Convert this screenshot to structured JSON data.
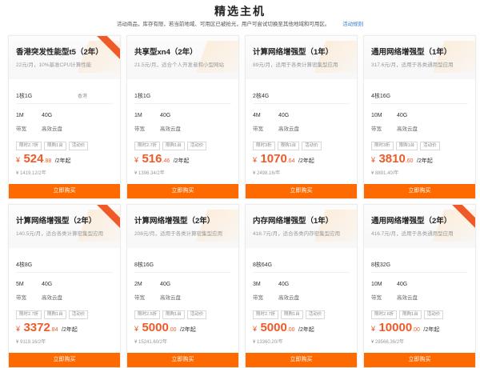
{
  "header": {
    "title": "精选主机",
    "subtitle": "活动商品，库存有限，若当前地域、可用区已被抢光，用户可尝试切换至其他地域和可用区。",
    "rules_link": "活动规则"
  },
  "labels": {
    "bandwidth": "带宽",
    "disk": "高效云盘",
    "buy": "立即购买",
    "currency": "¥",
    "per_period": "/2年起"
  },
  "colors": {
    "accent": "#ff6a00",
    "price": "#f05a28",
    "link": "#3a7bd5"
  },
  "cards": [
    {
      "title": "香港突发性能型t5（2年）",
      "desc": "22元/月，10%基准CPU计算性能",
      "spec": "1核1G",
      "note": "香港",
      "bandwidth": "1M",
      "disk": "40G",
      "tags": [
        "限时2.7折",
        "限购1台",
        "活动价"
      ],
      "price_int": "524",
      "price_dec": ".88",
      "orig": "¥ 1419.12/2年",
      "ribbon": true
    },
    {
      "title": "共享型xn4（2年）",
      "desc": "21.5元/月，适合个人开发者和小型网站",
      "spec": "1核1G",
      "note": "",
      "bandwidth": "1M",
      "disk": "40G",
      "tags": [
        "限时2.7折",
        "限购1台",
        "活动价"
      ],
      "price_int": "516",
      "price_dec": ".46",
      "orig": "¥ 1396.34/2年",
      "ribbon": false
    },
    {
      "title": "计算网络增强型（1年）",
      "desc": "89元/月，适用于各类计算密集型应用",
      "spec": "2核4G",
      "note": "",
      "bandwidth": "4M",
      "disk": "40G",
      "tags": [
        "限时3折",
        "限购1台",
        "活动价"
      ],
      "price_int": "1070",
      "price_dec": ".64",
      "orig": "¥ 2498.16/年",
      "ribbon": false
    },
    {
      "title": "通用网络增强型（1年）",
      "desc": "317.6元/月，适用于各类通用型应用",
      "spec": "4核16G",
      "note": "",
      "bandwidth": "10M",
      "disk": "40G",
      "tags": [
        "限时3折",
        "限购1台",
        "活动价"
      ],
      "price_int": "3810",
      "price_dec": ".60",
      "orig": "¥ 8891.40/年",
      "ribbon": false
    },
    {
      "title": "计算网络增强型（2年）",
      "desc": "140.5元/月，适合各类计算密集型应用",
      "spec": "4核8G",
      "note": "",
      "bandwidth": "5M",
      "disk": "40G",
      "tags": [
        "限时2.7折",
        "限购1台",
        "活动价"
      ],
      "price_int": "3372",
      "price_dec": ".84",
      "orig": "¥ 9119.16/2年",
      "ribbon": true
    },
    {
      "title": "计算网络增强型（2年）",
      "desc": "208元/月，适用于各类计算密集型应用",
      "spec": "8核16G",
      "note": "",
      "bandwidth": "2M",
      "disk": "40G",
      "tags": [
        "限时2.5折",
        "限购1台",
        "活动价"
      ],
      "price_int": "5000",
      "price_dec": ".00",
      "orig": "¥ 15241.60/2年",
      "ribbon": false
    },
    {
      "title": "内存网络增强型（1年）",
      "desc": "416.7元/月，适合各类内存密集型应用",
      "spec": "8核64G",
      "note": "",
      "bandwidth": "3M",
      "disk": "40G",
      "tags": [
        "限时2.7折",
        "限购1台",
        "活动价"
      ],
      "price_int": "5000",
      "price_dec": ".00",
      "orig": "¥ 13360.20/年",
      "ribbon": false
    },
    {
      "title": "通用网络增强型（2年）",
      "desc": "416.7元/月，适用于各类通用型应用",
      "spec": "8核32G",
      "note": "",
      "bandwidth": "10M",
      "disk": "40G",
      "tags": [
        "限时2.6折",
        "限购1台",
        "活动价"
      ],
      "price_int": "10000",
      "price_dec": ".00",
      "orig": "¥ 28566.36/2年",
      "ribbon": true
    }
  ]
}
